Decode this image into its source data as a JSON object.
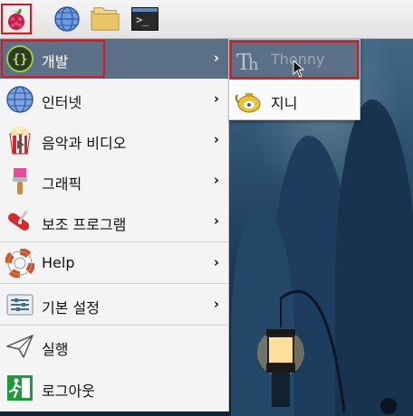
{
  "menu": {
    "items": [
      {
        "label": "개발",
        "has_submenu": true
      },
      {
        "label": "인터넷",
        "has_submenu": true
      },
      {
        "label": "음악과 비디오",
        "has_submenu": true
      },
      {
        "label": "그래픽",
        "has_submenu": true
      },
      {
        "label": "보조 프로그램",
        "has_submenu": true
      },
      {
        "label": "Help",
        "has_submenu": true
      },
      {
        "label": "기본 설정",
        "has_submenu": true
      },
      {
        "label": "실행",
        "has_submenu": false
      },
      {
        "label": "로그아웃",
        "has_submenu": false
      }
    ],
    "chevron": "›",
    "selected": "개발"
  },
  "submenu": {
    "items": [
      {
        "label": "Thonny",
        "state": "hovered-disabled"
      },
      {
        "label": "지니",
        "state": "normal"
      }
    ]
  },
  "taskbar": {
    "terminal_glyph": ">_"
  },
  "colors": {
    "highlight": "#5c7187",
    "annotation_box": "#e1141b",
    "menu_bg": "#f4f4f4"
  },
  "icons": {
    "taskbar": [
      "raspberry-pi-menu-icon",
      "web-browser-icon",
      "file-manager-icon",
      "terminal-icon"
    ],
    "menu": [
      "programming-braces-icon",
      "globe-icon",
      "popcorn-icon",
      "paintbrush-icon",
      "swiss-knife-icon",
      "life-ring-icon",
      "preferences-icon",
      "run-paper-plane-icon",
      "exit-running-man-icon"
    ],
    "submenu": [
      "thonny-icon",
      "geany-teapot-icon"
    ]
  }
}
